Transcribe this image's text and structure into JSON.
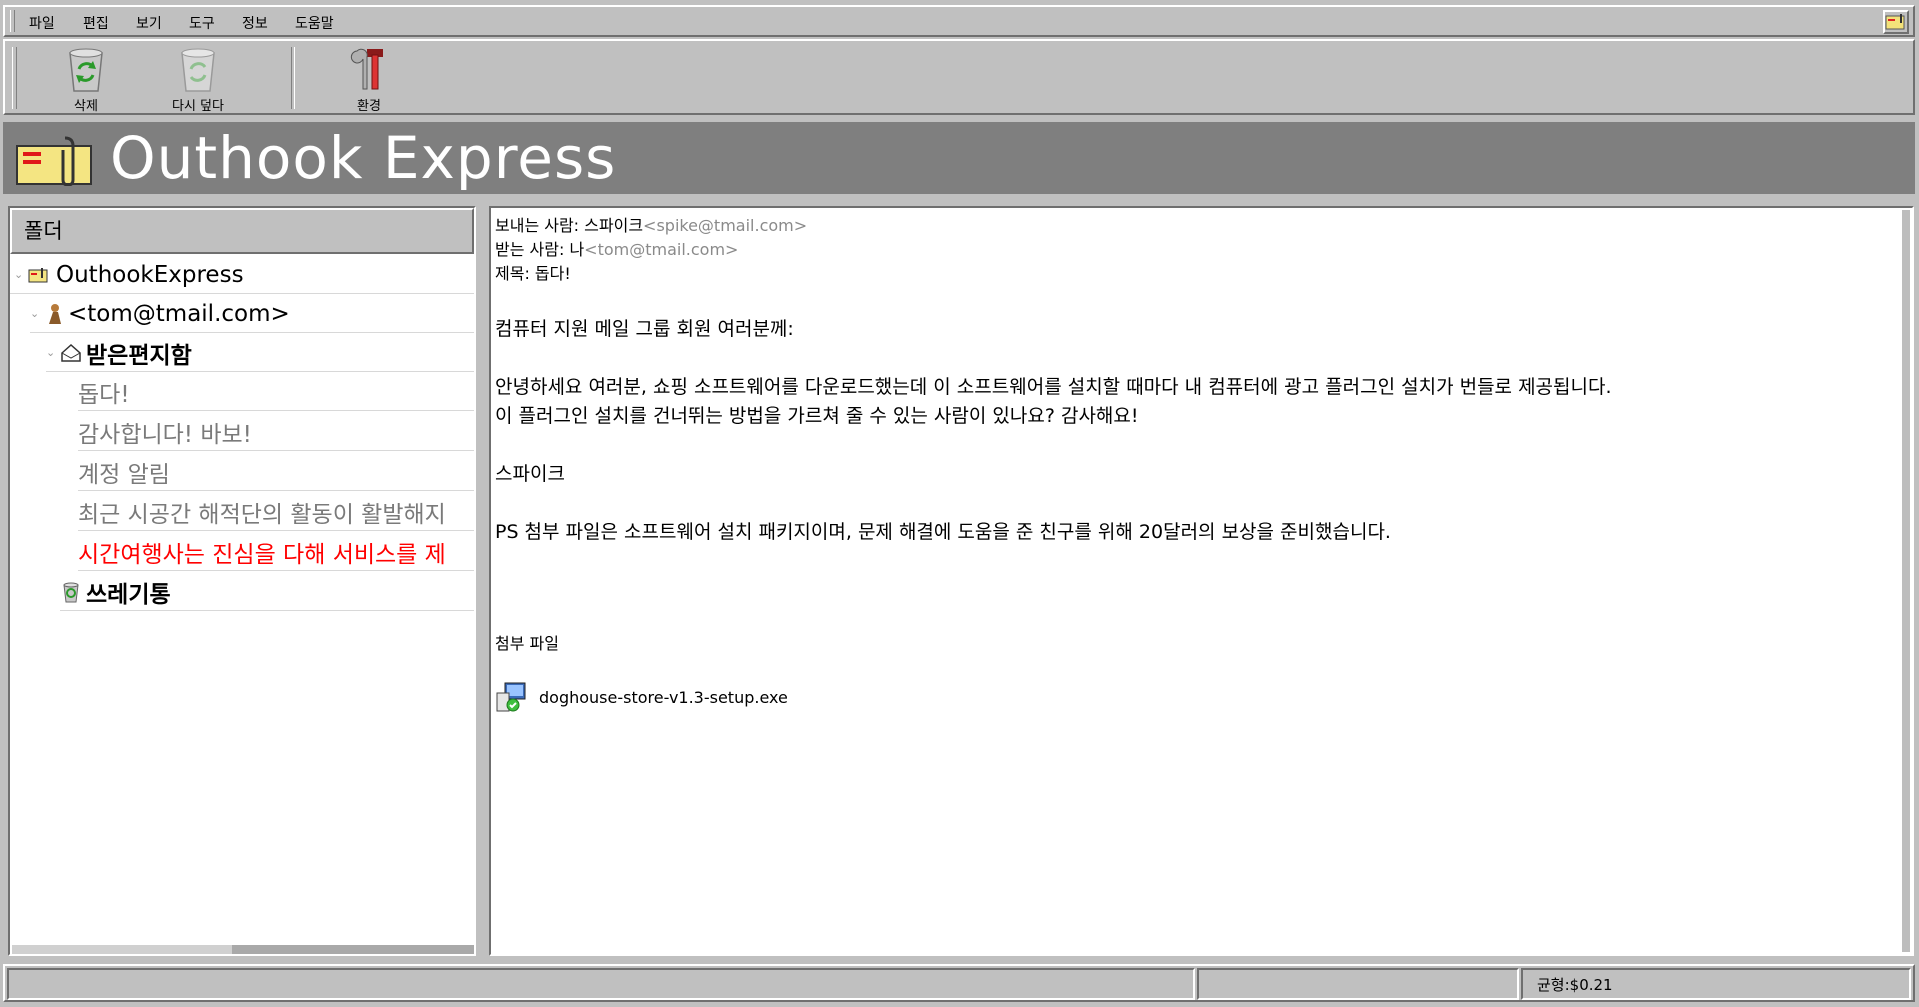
{
  "menu": {
    "items": [
      "파일",
      "편집",
      "보기",
      "도구",
      "정보",
      "도움말"
    ]
  },
  "toolbar": {
    "delete_label": "삭제",
    "redo_label": "다시 덮다",
    "settings_label": "환경"
  },
  "banner": {
    "title": "Outhook Express"
  },
  "folder_panel": {
    "header": "폴더",
    "root": "OuthookExpress",
    "account": "<tom@tmail.com>",
    "inbox": "받은편지함",
    "messages": [
      {
        "subject": "돕다!",
        "unread": false
      },
      {
        "subject": "감사합니다! 바보!",
        "unread": false
      },
      {
        "subject": "계정 알림",
        "unread": false
      },
      {
        "subject": "최근 시공간 해적단의 활동이 활발해지",
        "unread": false
      },
      {
        "subject": "시간여행사는 진심을 다해 서비스를 제",
        "unread": true
      }
    ],
    "trash": "쓰레기통"
  },
  "message": {
    "from_label": "보내는 사람: 스파이크",
    "from_addr": "<spike@tmail.com>",
    "to_label": "받는 사람: 나",
    "to_addr": "<tom@tmail.com>",
    "subject_line": "제목: 돕다!",
    "greeting": "컴퓨터 지원 메일 그룹 회원 여러분께:",
    "body1": "안녕하세요 여러분, 쇼핑 소프트웨어를 다운로드했는데 이 소프트웨어를 설치할 때마다 내 컴퓨터에 광고 플러그인 설치가 번들로 제공됩니다.",
    "body2": "이 플러그인 설치를 건너뛰는 방법을 가르쳐 줄 수 있는 사람이 있나요? 감사해요!",
    "signature": "스파이크",
    "ps": "PS 첨부 파일은 소프트웨어 설치 패키지이며, 문제 해결에 도움을 준 친구를 위해 20달러의 보상을 준비했습니다.",
    "attachments_title": "첨부 파일",
    "attachment_name": "doghouse-store-v1.3-setup.exe"
  },
  "status": {
    "balance": "균형:$0.21"
  },
  "colors": {
    "banner": "#7f7f7f",
    "unread": "#ff0000",
    "chrome": "#c0c0c0"
  }
}
